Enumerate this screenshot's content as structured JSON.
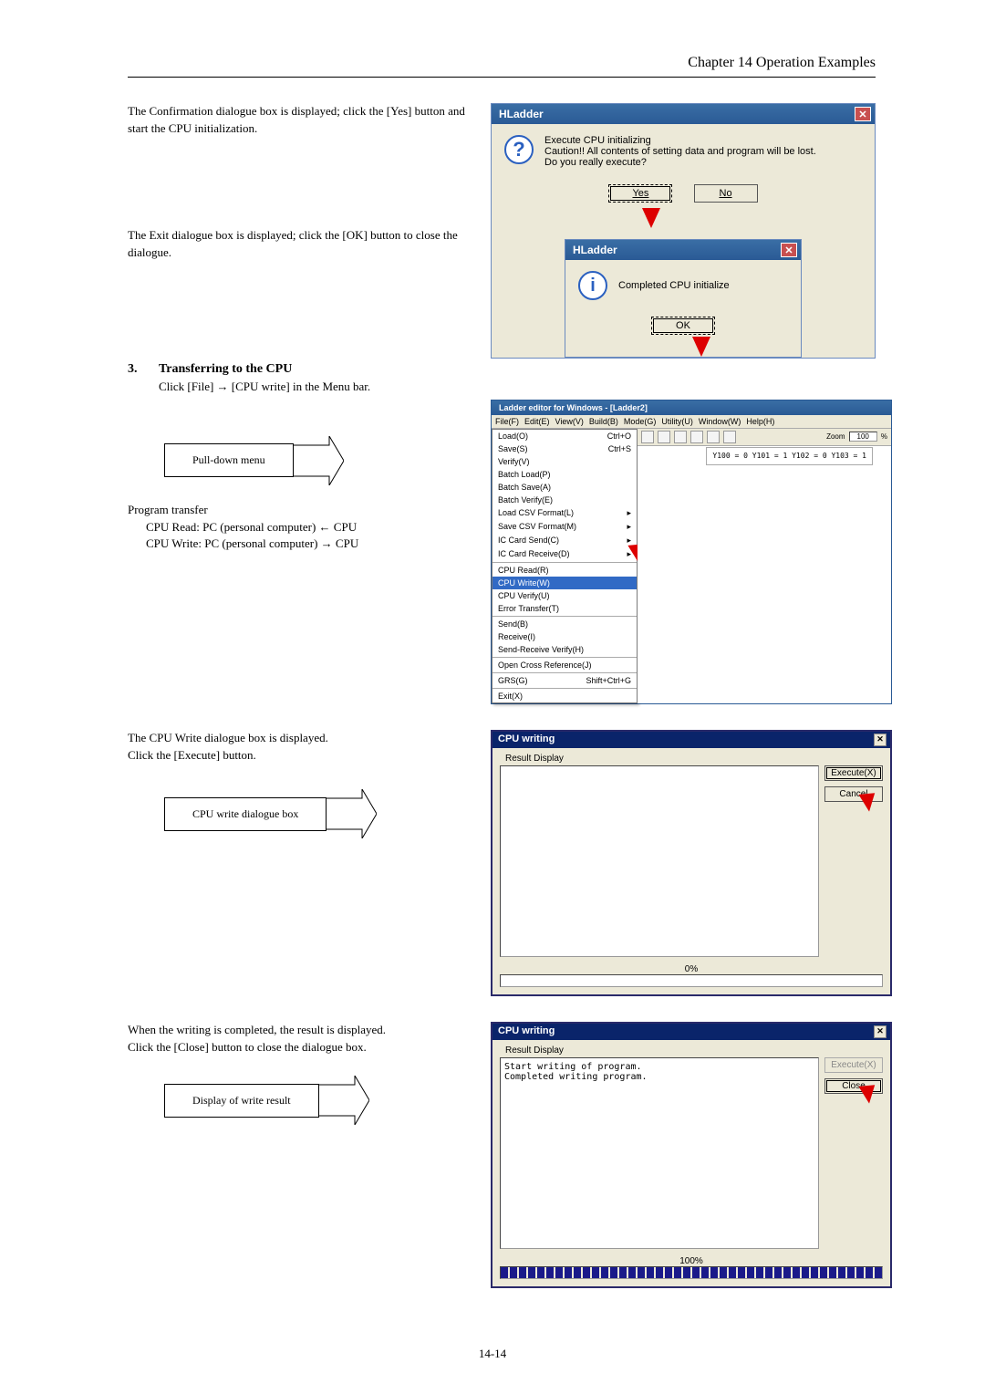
{
  "header": "Chapter 14  Operation Examples",
  "para1": "The Confirmation dialogue box is displayed; click the [Yes] button and start the CPU initialization.",
  "para2": "The Exit dialogue box is displayed; click the [OK] button to close the dialogue.",
  "confirm_dialog": {
    "title": "HLadder",
    "line1": "Execute CPU initializing",
    "line2": "Caution!! All contents of setting data and program will be lost.",
    "line3": "Do you really execute?",
    "yes": "Yes",
    "no": "No"
  },
  "done_dialog": {
    "title": "HLadder",
    "msg": "Completed CPU initialize",
    "ok": "OK"
  },
  "step3": {
    "num": "3.",
    "title": "Transferring to the CPU",
    "body": "Click [File] → [CPU write] in the Menu bar."
  },
  "callout_pulldown": "Pull-down menu",
  "program_transfer": {
    "heading": "Program transfer",
    "line1": "CPU Read: PC (personal computer) ← CPU",
    "line2": "CPU Write: PC (personal computer) → CPU"
  },
  "para3a": "The CPU Write dialogue box is displayed.",
  "para3b": "Click the [Execute] button.",
  "callout_cpu_write": "CPU write dialogue box",
  "app": {
    "title": "Ladder editor for Windows - [Ladder2]",
    "menus": [
      "File(F)",
      "Edit(E)",
      "View(V)",
      "Build(B)",
      "Mode(G)",
      "Utility(U)",
      "Window(W)",
      "Help(H)"
    ],
    "zoom_label": "Zoom",
    "zoom_value": "100",
    "zoom_pct": "%",
    "file_items": [
      {
        "l": "Load(O)",
        "r": "Ctrl+O"
      },
      {
        "l": "Save(S)",
        "r": "Ctrl+S"
      },
      {
        "l": "Verify(V)",
        "r": ""
      },
      {
        "l": "Batch Load(P)",
        "r": ""
      },
      {
        "l": "Batch Save(A)",
        "r": ""
      },
      {
        "l": "Batch Verify(E)",
        "r": ""
      },
      {
        "l": "Load CSV Format(L)",
        "r": "▸"
      },
      {
        "l": "Save CSV Format(M)",
        "r": "▸"
      },
      {
        "l": "IC Card Send(C)",
        "r": "▸"
      },
      {
        "l": "IC Card Receive(D)",
        "r": "▸"
      }
    ],
    "file_items2": [
      {
        "l": "CPU Read(R)",
        "r": ""
      },
      {
        "l": "CPU Write(W)",
        "r": "",
        "sel": true
      },
      {
        "l": "CPU Verify(U)",
        "r": ""
      },
      {
        "l": "Error Transfer(T)",
        "r": ""
      }
    ],
    "file_items3": [
      {
        "l": "Send(B)",
        "r": ""
      },
      {
        "l": "Receive(I)",
        "r": ""
      },
      {
        "l": "Send-Receive Verify(H)",
        "r": ""
      }
    ],
    "file_items4": [
      {
        "l": "Open Cross Reference(J)",
        "r": ""
      }
    ],
    "file_items5": [
      {
        "l": "GRS(G)",
        "r": "Shift+Ctrl+G"
      }
    ],
    "file_items6": [
      {
        "l": "Exit(X)",
        "r": ""
      }
    ],
    "balloon": "Y100 = 0\nY101 = 1\nY102 = 0\nY103 = 1"
  },
  "cpu_write1": {
    "title": "CPU writing",
    "tab": "Result Display",
    "execute": "Execute(X)",
    "cancel": "Cancel",
    "progress": "0%"
  },
  "para4a": "When the writing is completed, the result is displayed.",
  "para4b": "Click the [Close] button to close the dialogue box.",
  "callout_write_result": "Display of write result",
  "cpu_write2": {
    "title": "CPU writing",
    "tab": "Result Display",
    "result_text": "Start writing of program.\nCompleted writing program.",
    "execute": "Execute(X)",
    "close": "Close",
    "progress": "100%"
  },
  "page_number": "14-14"
}
